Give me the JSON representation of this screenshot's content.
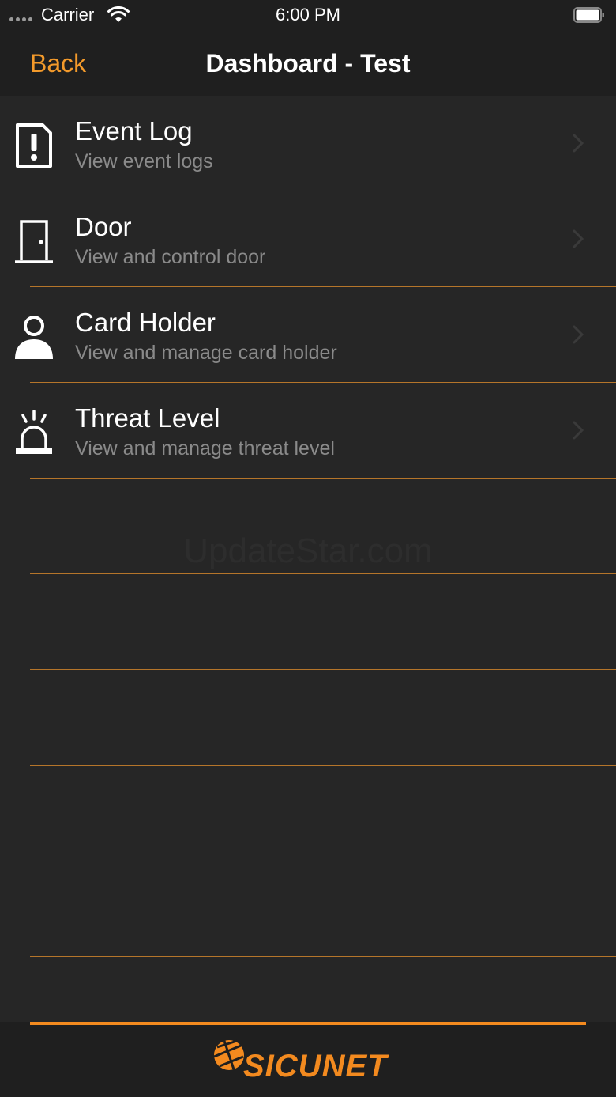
{
  "status_bar": {
    "carrier": "Carrier",
    "time": "6:00 PM",
    "icons": [
      "signal-dots-icon",
      "wifi-icon",
      "battery-icon"
    ]
  },
  "nav": {
    "back_label": "Back",
    "title": "Dashboard - Test"
  },
  "menu": {
    "items": [
      {
        "title": "Event Log",
        "subtitle": "View event logs",
        "icon": "alert-document-icon"
      },
      {
        "title": "Door",
        "subtitle": "View and control door",
        "icon": "door-icon"
      },
      {
        "title": "Card Holder",
        "subtitle": "View and manage card holder",
        "icon": "person-icon"
      },
      {
        "title": "Threat Level",
        "subtitle": "View and manage threat level",
        "icon": "alarm-siren-icon"
      }
    ],
    "empty_rows": 5
  },
  "watermark": "UpdateStar.com",
  "footer": {
    "logo_text": "SICUNET"
  },
  "colors": {
    "accent": "#f39a2b",
    "background": "#262626",
    "bar_background": "#1f1f1f",
    "separator": "#b5752a",
    "subtitle": "#8a8a8a",
    "title": "#ffffff"
  }
}
